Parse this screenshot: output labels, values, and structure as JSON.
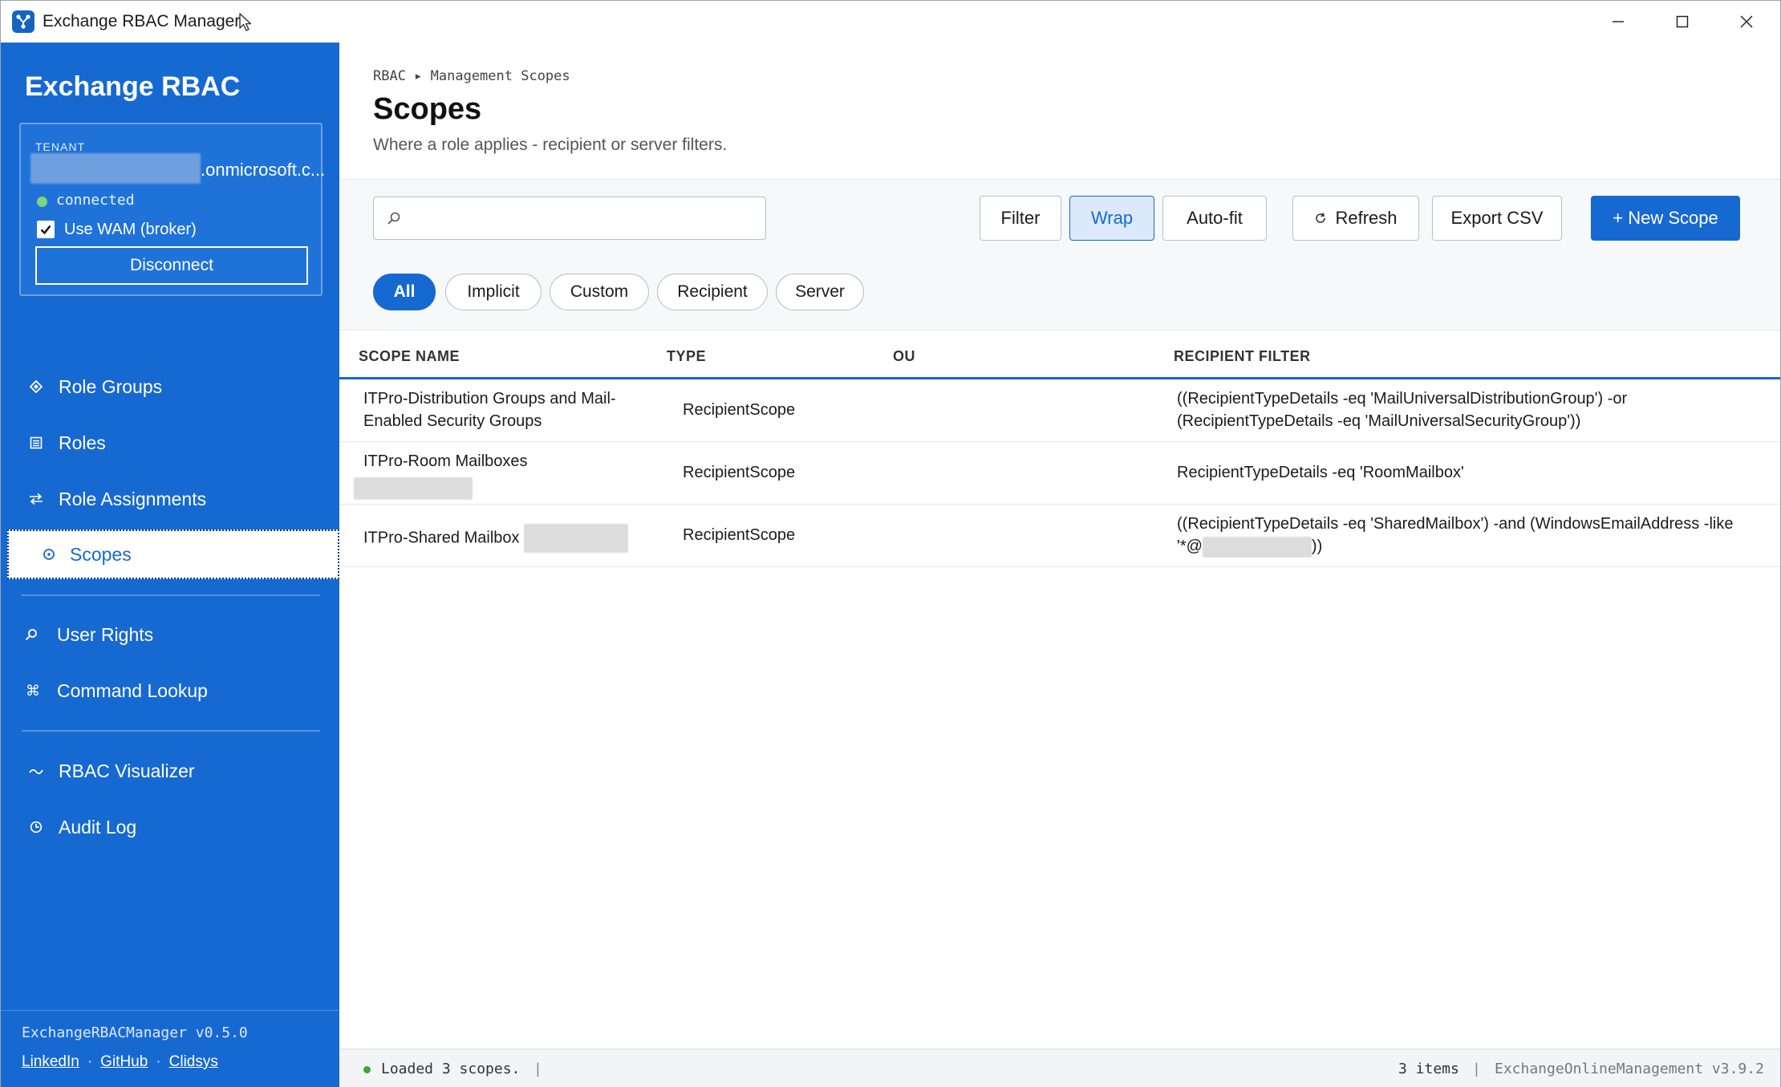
{
  "window": {
    "title": "Exchange RBAC Manager",
    "icon": "app-logo-icon",
    "controls": [
      "minimize-icon",
      "maximize-icon",
      "close-icon"
    ]
  },
  "sidebar": {
    "brand": "Exchange RBAC",
    "tenant": {
      "label": "TENANT",
      "domain_suffix": ".onmicrosoft.c...",
      "status": "connected",
      "status_color": "#7bd67e",
      "wam_label": "Use WAM (broker)",
      "wam_checked": true,
      "disconnect_label": "Disconnect"
    },
    "nav": [
      {
        "label": "Role Groups",
        "icon": "diamond-icon"
      },
      {
        "label": "Roles",
        "icon": "list-icon"
      },
      {
        "label": "Role Assignments",
        "icon": "swap-arrows-icon"
      },
      {
        "label": "Scopes",
        "icon": "target-icon",
        "active": true
      },
      {
        "label": "User Rights",
        "icon": "search-icon"
      },
      {
        "label": "Command Lookup",
        "icon": "command-icon"
      },
      {
        "label": "RBAC Visualizer",
        "icon": "trend-icon"
      },
      {
        "label": "Audit Log",
        "icon": "clock-icon"
      }
    ],
    "version": "ExchangeRBACManager v0.5.0",
    "links": [
      "LinkedIn",
      "GitHub",
      "Clidsys"
    ],
    "link_separator": "·"
  },
  "main": {
    "breadcrumb": "RBAC ▸ Management Scopes",
    "title": "Scopes",
    "subtitle": "Where a role applies - recipient or server filters.",
    "search": {
      "placeholder": "",
      "value": ""
    },
    "toolbar": {
      "filter": "Filter",
      "wrap": "Wrap",
      "autofit": "Auto-fit",
      "refresh": "Refresh",
      "export": "Export CSV",
      "new_scope": "+ New Scope"
    },
    "chips": [
      {
        "label": "All",
        "active": true
      },
      {
        "label": "Implicit"
      },
      {
        "label": "Custom"
      },
      {
        "label": "Recipient"
      },
      {
        "label": "Server"
      }
    ],
    "table": {
      "columns": [
        "SCOPE NAME",
        "TYPE",
        "OU",
        "RECIPIENT FILTER"
      ],
      "rows": [
        {
          "name_line1": "ITPro-Distribution Groups and Mail-",
          "name_line2": "Enabled Security Groups",
          "type": "RecipientScope",
          "ou": "",
          "filter_line1": "((RecipientTypeDetails -eq 'MailUniversalDistributionGroup') -or",
          "filter_line2": "(RecipientTypeDetails -eq 'MailUniversalSecurityGroup'))"
        },
        {
          "name_line1": "ITPro-Room Mailboxes",
          "type": "RecipientScope",
          "ou": "",
          "filter_line1": "RecipientTypeDetails -eq 'RoomMailbox'"
        },
        {
          "name_line1": "ITPro-Shared Mailbox",
          "type": "RecipientScope",
          "ou": "",
          "filter_line1": "((RecipientTypeDetails -eq 'SharedMailbox') -and (WindowsEmailAddress -like",
          "filter_line2_prefix": "'*@",
          "filter_line2_suffix": "))"
        }
      ]
    },
    "status": {
      "message": "Loaded 3 scopes.",
      "separator": "|",
      "count": "3 items",
      "module": "ExchangeOnlineManagement v3.9.2",
      "dot_color": "#3aa63f"
    }
  },
  "colors": {
    "accent": "#1769d2",
    "sidebar_bg": "#1769d2",
    "toggle_bg": "#dbe9fb"
  }
}
